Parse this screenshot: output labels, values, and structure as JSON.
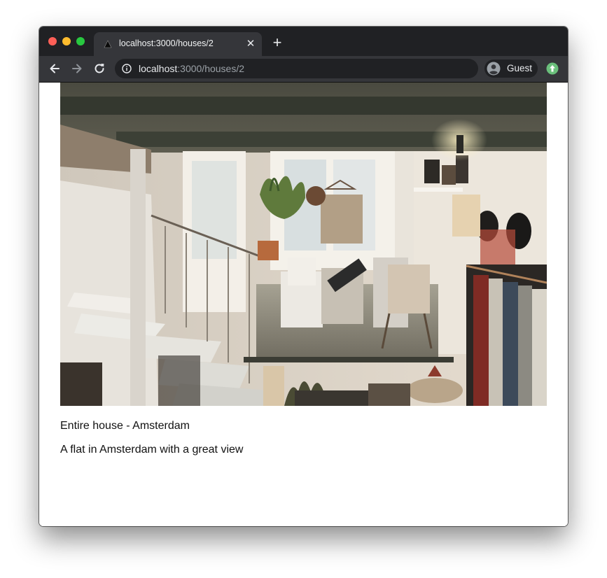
{
  "browser": {
    "tab": {
      "title": "localhost:3000/houses/2",
      "close_glyph": "✕",
      "favicon": "triangle-favicon-icon"
    },
    "new_tab_glyph": "+",
    "address": {
      "host": "localhost",
      "path": ":3000/houses/2"
    },
    "profile": {
      "label": "Guest"
    }
  },
  "page": {
    "image": {
      "subject": "interior-photo"
    },
    "house_type": "Entire house - Amsterdam",
    "description": "A flat in Amsterdam with a great view"
  },
  "colors": {
    "tabstrip": "#202124",
    "toolbar": "#35363a",
    "traffic_close": "#fe5f57",
    "traffic_min": "#febc2e",
    "traffic_max": "#28c840",
    "extension": "#6abf7b"
  }
}
